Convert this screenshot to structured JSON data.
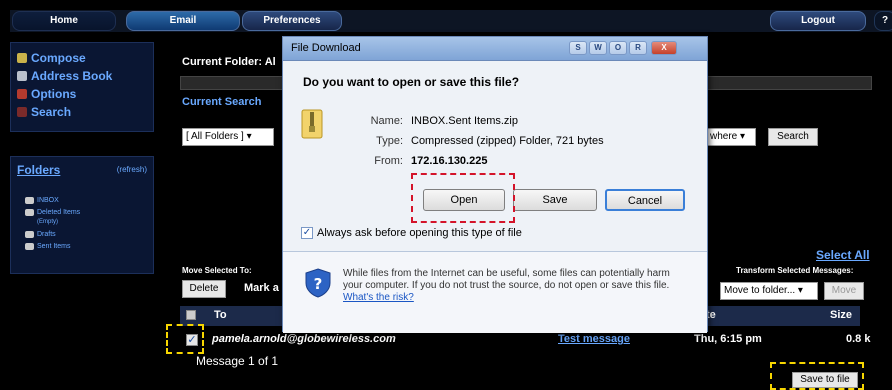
{
  "nav": {
    "home": "Home",
    "email": "Email",
    "preferences": "Preferences",
    "logout": "Logout",
    "help": "?"
  },
  "menu": {
    "items": [
      "Compose",
      "Address Book",
      "Options",
      "Search"
    ]
  },
  "folders": {
    "title": "Folders",
    "refresh": "(refresh)",
    "items": [
      "INBOX",
      "Deleted Items",
      "Drafts",
      "Sent Items"
    ],
    "deleted_note": "(Empty)"
  },
  "main": {
    "current_folder": "Current Folder: Al",
    "current_search": "Current Search",
    "all_folders": "[ All Folders ]",
    "where": "where",
    "search_button": "Search",
    "select_all": "Select All",
    "move_selected": "Move Selected To:",
    "delete_button": "Delete",
    "mark_as": "Mark a",
    "transform_label": "Transform Selected Messages:",
    "move_to_folder": "Move to folder...",
    "move_button": "Move",
    "message_count": "Message 1 of 1",
    "save_to_file": "Save to file"
  },
  "table": {
    "columns": {
      "to": "To",
      "date": "te",
      "size": "Size"
    },
    "row": {
      "to": "pamela.arnold@globewireless.com",
      "subject": "Test message",
      "date": "Thu, 6:15 pm",
      "size": "0.8 k"
    }
  },
  "dialog": {
    "title": "File Download",
    "question": "Do you want to open or save this file?",
    "name_label": "Name:",
    "name_value": "INBOX.Sent Items.zip",
    "type_label": "Type:",
    "type_value": "Compressed (zipped) Folder, 721 bytes",
    "from_label": "From:",
    "from_value": "172.16.130.225",
    "open_button": "Open",
    "save_button": "Save",
    "cancel_button": "Cancel",
    "always_ask": "Always ask before opening this type of file",
    "info_text": "While files from the Internet can be useful, some files can potentially harm your computer. If you do not trust the source, do not open or save this file.",
    "info_link": "What's the risk?",
    "titlebar_buttons": [
      "S",
      "W",
      "O",
      "R",
      "X"
    ]
  },
  "colors": {
    "highlight_red": "#d4142a",
    "highlight_yellow": "#f7d600",
    "link_blue": "#6aa9ff"
  }
}
